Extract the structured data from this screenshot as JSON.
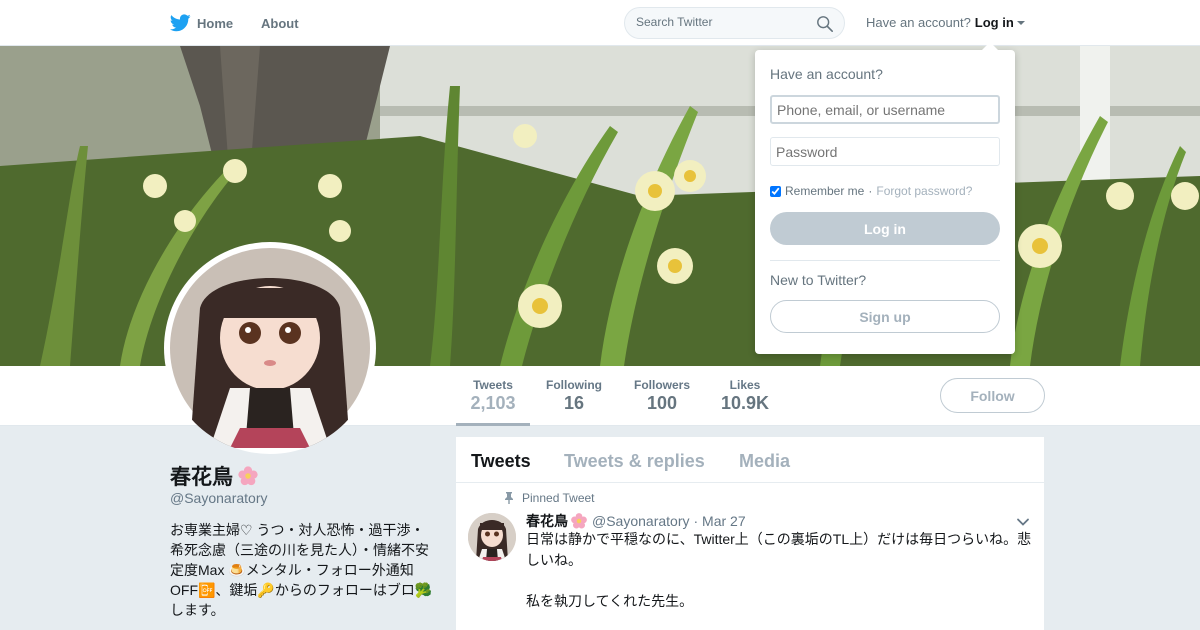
{
  "nav": {
    "home_label": "Home",
    "about_label": "About",
    "search_placeholder": "Search Twitter",
    "have_account": "Have an account?",
    "login_label": "Log in",
    "brand_color": "#1da1f2",
    "icons": {
      "logo": "twitter-bird-icon",
      "search": "search-icon",
      "caret": "caret-down-icon"
    }
  },
  "profile": {
    "name": "春花鳥",
    "name_emoji": "flower-icon",
    "handle": "@Sayonaratory",
    "bio": "お専業主婦♡ うつ・対人恐怖・過干渉・希死念慮（三途の川を見た人）・情緒不安定度Max 🍮メンタル・フォロー外通知OFF📴、鍵垢🔑からのフォローはブロ🥦します。"
  },
  "stats": [
    {
      "label": "Tweets",
      "value": "2,103",
      "active": true
    },
    {
      "label": "Following",
      "value": "16",
      "active": false
    },
    {
      "label": "Followers",
      "value": "100",
      "active": false
    },
    {
      "label": "Likes",
      "value": "10.9K",
      "active": false
    }
  ],
  "follow_label": "Follow",
  "timeline": {
    "tabs": [
      {
        "label": "Tweets",
        "active": true
      },
      {
        "label": "Tweets & replies",
        "active": false
      },
      {
        "label": "Media",
        "active": false
      }
    ],
    "pinned_label": "Pinned Tweet",
    "tweet": {
      "name": "春花鳥",
      "handle": "@Sayonaratory",
      "date": "· Mar 27",
      "text_p1": "日常は静かで平穏なのに、Twitter上（この裏垢のTL上）だけは毎日つらいね。悲しいね。",
      "text_p2": "私を執刀してくれた先生。"
    }
  },
  "login_dropdown": {
    "title": "Have an account?",
    "username_placeholder": "Phone, email, or username",
    "password_placeholder": "Password",
    "remember_label": "Remember me",
    "remember_checked": true,
    "separator": "·",
    "forgot_label": "Forgot password?",
    "login_button": "Log in",
    "new_label": "New to Twitter?",
    "signup_button": "Sign up"
  }
}
